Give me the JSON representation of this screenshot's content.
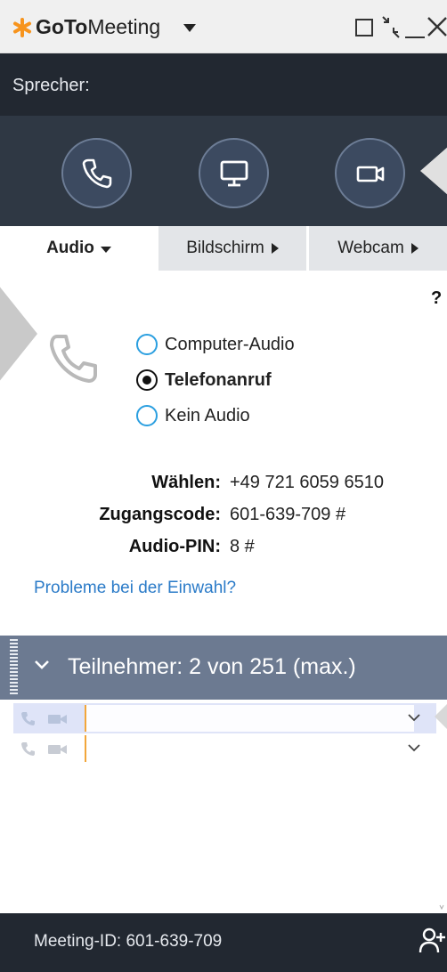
{
  "window": {
    "app_name_bold": "GoTo",
    "app_name_rest": "Meeting"
  },
  "speaker": {
    "label": "Sprecher:"
  },
  "controls": {
    "buttons": [
      {
        "icon": "phone-icon"
      },
      {
        "icon": "monitor-icon"
      },
      {
        "icon": "webcam-icon"
      }
    ]
  },
  "tabs": [
    {
      "label": "Audio",
      "active": true
    },
    {
      "label": "Bildschirm",
      "active": false
    },
    {
      "label": "Webcam",
      "active": false
    }
  ],
  "audio": {
    "help": "?",
    "options": [
      {
        "label": "Computer-Audio",
        "selected": false
      },
      {
        "label": "Telefonanruf",
        "selected": true
      },
      {
        "label": "Kein Audio",
        "selected": false
      }
    ],
    "info": [
      {
        "label": "Wählen:",
        "value": "+49 721 6059 6510"
      },
      {
        "label": "Zugangscode:",
        "value": "601-639-709 #"
      },
      {
        "label": "Audio-PIN:",
        "value": "8 #"
      }
    ],
    "trouble_link": "Probleme bei der Einwahl?"
  },
  "participants": {
    "title": "Teilnehmer:  2 von 251 (max.)",
    "rows": [
      {
        "name": ""
      },
      {
        "name": ""
      }
    ]
  },
  "footer": {
    "meeting_id": "Meeting-ID: 601-639-709"
  },
  "colors": {
    "accent": "#2b9fe0",
    "logo": "#f7941d",
    "dark_panel": "#2f3844",
    "participants_header": "#6c7a91"
  }
}
